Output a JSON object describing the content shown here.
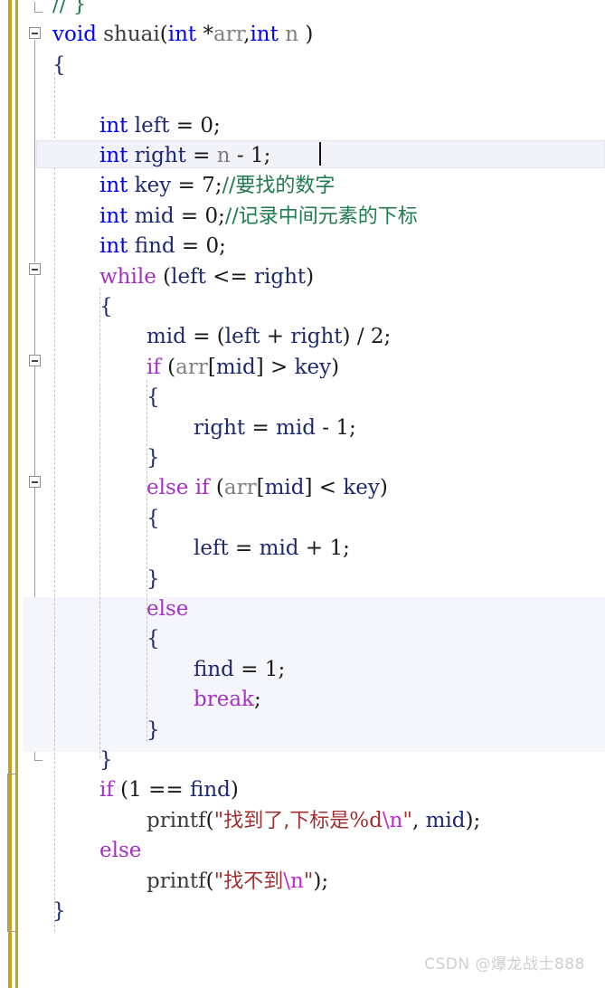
{
  "editor": {
    "language": "C",
    "theme": "light",
    "font_family_style": "serif-monospaced",
    "colors": {
      "background": "#ffffff",
      "keyword": "#0000ff",
      "control_keyword": "#a431c6",
      "identifier": "#1f2a6e",
      "parameter": "#808080",
      "comment": "#1f7a4d",
      "string": "#a03030",
      "escape": "#c02ad0",
      "change_bar": "#C9A21B",
      "current_line_bg": "#f2f3f9",
      "block_highlight_bg": "#f4f6fb",
      "fold_line": "#9a9a9a",
      "indent_guide": "#c2c2c2",
      "watermark": "#cfcfcf"
    },
    "current_line_number": 2,
    "caret_visible": true
  },
  "code": {
    "lines": [
      {
        "n": 0,
        "indent": 0,
        "tokens": [
          {
            "t": "// }",
            "c": "cmt"
          }
        ]
      },
      {
        "n": 1,
        "indent": 0,
        "tokens": [
          {
            "t": "void",
            "c": "kw"
          },
          {
            "t": " ",
            "c": "op"
          },
          {
            "t": "shuai",
            "c": "fn"
          },
          {
            "t": "(",
            "c": "op"
          },
          {
            "t": "int",
            "c": "kw"
          },
          {
            "t": " *",
            "c": "op"
          },
          {
            "t": "arr",
            "c": "par"
          },
          {
            "t": ",",
            "c": "op"
          },
          {
            "t": "int",
            "c": "kw"
          },
          {
            "t": " ",
            "c": "op"
          },
          {
            "t": "n",
            "c": "par"
          },
          {
            "t": " )",
            "c": "op"
          }
        ]
      },
      {
        "n": 2,
        "indent": 0,
        "tokens": [
          {
            "t": "{",
            "c": "brc"
          }
        ]
      },
      {
        "n": 3,
        "indent": 0,
        "tokens": []
      },
      {
        "n": 4,
        "indent": 1,
        "tokens": [
          {
            "t": "int",
            "c": "kw"
          },
          {
            "t": " ",
            "c": "op"
          },
          {
            "t": "left",
            "c": "id"
          },
          {
            "t": " = ",
            "c": "op"
          },
          {
            "t": "0",
            "c": "num"
          },
          {
            "t": ";",
            "c": "op"
          }
        ]
      },
      {
        "n": 5,
        "indent": 1,
        "tokens": [
          {
            "t": "int",
            "c": "kw"
          },
          {
            "t": " ",
            "c": "op"
          },
          {
            "t": "right",
            "c": "id"
          },
          {
            "t": " = ",
            "c": "op"
          },
          {
            "t": "n",
            "c": "par"
          },
          {
            "t": " - ",
            "c": "op"
          },
          {
            "t": "1",
            "c": "num"
          },
          {
            "t": ";",
            "c": "op"
          }
        ]
      },
      {
        "n": 6,
        "indent": 1,
        "tokens": [
          {
            "t": "int",
            "c": "kw"
          },
          {
            "t": " ",
            "c": "op"
          },
          {
            "t": "key",
            "c": "id"
          },
          {
            "t": " = ",
            "c": "op"
          },
          {
            "t": "7",
            "c": "num"
          },
          {
            "t": ";",
            "c": "op"
          },
          {
            "t": "//要找的数字",
            "c": "cmt cjk"
          }
        ]
      },
      {
        "n": 7,
        "indent": 1,
        "tokens": [
          {
            "t": "int",
            "c": "kw"
          },
          {
            "t": " ",
            "c": "op"
          },
          {
            "t": "mid",
            "c": "id"
          },
          {
            "t": " = ",
            "c": "op"
          },
          {
            "t": "0",
            "c": "num"
          },
          {
            "t": ";",
            "c": "op"
          },
          {
            "t": "//记录中间元素的下标",
            "c": "cmt cjk"
          }
        ]
      },
      {
        "n": 8,
        "indent": 1,
        "tokens": [
          {
            "t": "int",
            "c": "kw"
          },
          {
            "t": " ",
            "c": "op"
          },
          {
            "t": "find",
            "c": "id"
          },
          {
            "t": " = ",
            "c": "op"
          },
          {
            "t": "0",
            "c": "num"
          },
          {
            "t": ";",
            "c": "op"
          }
        ]
      },
      {
        "n": 9,
        "indent": 1,
        "tokens": [
          {
            "t": "while",
            "c": "ctl"
          },
          {
            "t": " (",
            "c": "op"
          },
          {
            "t": "left",
            "c": "id"
          },
          {
            "t": " <= ",
            "c": "op"
          },
          {
            "t": "right",
            "c": "id"
          },
          {
            "t": ")",
            "c": "op"
          }
        ]
      },
      {
        "n": 10,
        "indent": 1,
        "tokens": [
          {
            "t": "{",
            "c": "brc"
          }
        ]
      },
      {
        "n": 11,
        "indent": 2,
        "tokens": [
          {
            "t": "mid",
            "c": "id"
          },
          {
            "t": " = (",
            "c": "op"
          },
          {
            "t": "left",
            "c": "id"
          },
          {
            "t": " + ",
            "c": "op"
          },
          {
            "t": "right",
            "c": "id"
          },
          {
            "t": ") / ",
            "c": "op"
          },
          {
            "t": "2",
            "c": "num"
          },
          {
            "t": ";",
            "c": "op"
          }
        ]
      },
      {
        "n": 12,
        "indent": 2,
        "tokens": [
          {
            "t": "if",
            "c": "ctl"
          },
          {
            "t": " (",
            "c": "op"
          },
          {
            "t": "arr",
            "c": "par"
          },
          {
            "t": "[",
            "c": "op"
          },
          {
            "t": "mid",
            "c": "id"
          },
          {
            "t": "] > ",
            "c": "op"
          },
          {
            "t": "key",
            "c": "id"
          },
          {
            "t": ")",
            "c": "op"
          }
        ]
      },
      {
        "n": 13,
        "indent": 2,
        "tokens": [
          {
            "t": "{",
            "c": "brc"
          }
        ]
      },
      {
        "n": 14,
        "indent": 3,
        "tokens": [
          {
            "t": "right",
            "c": "id"
          },
          {
            "t": " = ",
            "c": "op"
          },
          {
            "t": "mid",
            "c": "id"
          },
          {
            "t": " - ",
            "c": "op"
          },
          {
            "t": "1",
            "c": "num"
          },
          {
            "t": ";",
            "c": "op"
          }
        ]
      },
      {
        "n": 15,
        "indent": 2,
        "tokens": [
          {
            "t": "}",
            "c": "brc"
          }
        ]
      },
      {
        "n": 16,
        "indent": 2,
        "tokens": [
          {
            "t": "else",
            "c": "ctl"
          },
          {
            "t": " ",
            "c": "op"
          },
          {
            "t": "if",
            "c": "ctl"
          },
          {
            "t": " (",
            "c": "op"
          },
          {
            "t": "arr",
            "c": "par"
          },
          {
            "t": "[",
            "c": "op"
          },
          {
            "t": "mid",
            "c": "id"
          },
          {
            "t": "] < ",
            "c": "op"
          },
          {
            "t": "key",
            "c": "id"
          },
          {
            "t": ")",
            "c": "op"
          }
        ]
      },
      {
        "n": 17,
        "indent": 2,
        "tokens": [
          {
            "t": "{",
            "c": "brc"
          }
        ]
      },
      {
        "n": 18,
        "indent": 3,
        "tokens": [
          {
            "t": "left",
            "c": "id"
          },
          {
            "t": " = ",
            "c": "op"
          },
          {
            "t": "mid",
            "c": "id"
          },
          {
            "t": " + ",
            "c": "op"
          },
          {
            "t": "1",
            "c": "num"
          },
          {
            "t": ";",
            "c": "op"
          }
        ]
      },
      {
        "n": 19,
        "indent": 2,
        "tokens": [
          {
            "t": "}",
            "c": "brc"
          }
        ]
      },
      {
        "n": 20,
        "indent": 2,
        "tokens": [
          {
            "t": "else",
            "c": "ctl"
          }
        ]
      },
      {
        "n": 21,
        "indent": 2,
        "tokens": [
          {
            "t": "{",
            "c": "brc"
          }
        ]
      },
      {
        "n": 22,
        "indent": 3,
        "tokens": [
          {
            "t": "find",
            "c": "id"
          },
          {
            "t": " = ",
            "c": "op"
          },
          {
            "t": "1",
            "c": "num"
          },
          {
            "t": ";",
            "c": "op"
          }
        ]
      },
      {
        "n": 23,
        "indent": 3,
        "tokens": [
          {
            "t": "break",
            "c": "ctl"
          },
          {
            "t": ";",
            "c": "op"
          }
        ]
      },
      {
        "n": 24,
        "indent": 2,
        "tokens": [
          {
            "t": "}",
            "c": "brc"
          }
        ]
      },
      {
        "n": 25,
        "indent": 1,
        "tokens": [
          {
            "t": "}",
            "c": "brc"
          }
        ]
      },
      {
        "n": 26,
        "indent": 1,
        "tokens": [
          {
            "t": "if",
            "c": "ctl"
          },
          {
            "t": " (",
            "c": "op"
          },
          {
            "t": "1",
            "c": "num"
          },
          {
            "t": " == ",
            "c": "op"
          },
          {
            "t": "find",
            "c": "id"
          },
          {
            "t": ")",
            "c": "op"
          }
        ]
      },
      {
        "n": 27,
        "indent": 2,
        "tokens": [
          {
            "t": "printf",
            "c": "fn"
          },
          {
            "t": "(",
            "c": "op"
          },
          {
            "t": "\"",
            "c": "str"
          },
          {
            "t": "找到了,下标是",
            "c": "str cjk"
          },
          {
            "t": "%d",
            "c": "str"
          },
          {
            "t": "\\n",
            "c": "esc"
          },
          {
            "t": "\"",
            "c": "str"
          },
          {
            "t": ", ",
            "c": "op"
          },
          {
            "t": "mid",
            "c": "id"
          },
          {
            "t": ");",
            "c": "op"
          }
        ]
      },
      {
        "n": 28,
        "indent": 1,
        "tokens": [
          {
            "t": "else",
            "c": "ctl"
          }
        ]
      },
      {
        "n": 29,
        "indent": 2,
        "tokens": [
          {
            "t": "printf",
            "c": "fn"
          },
          {
            "t": "(",
            "c": "op"
          },
          {
            "t": "\"",
            "c": "str"
          },
          {
            "t": "找不到",
            "c": "str cjk"
          },
          {
            "t": "\\n",
            "c": "esc"
          },
          {
            "t": "\"",
            "c": "str"
          },
          {
            "t": ");",
            "c": "op"
          }
        ]
      },
      {
        "n": 30,
        "indent": 0,
        "tokens": [
          {
            "t": "}",
            "c": "brc"
          }
        ]
      }
    ]
  },
  "gutter": {
    "change_bars": 2,
    "fold_markers": [
      {
        "name": "fold-function",
        "expanded": true,
        "line": 1
      },
      {
        "name": "fold-while",
        "expanded": true,
        "line": 9
      },
      {
        "name": "fold-if",
        "expanded": true,
        "line": 12
      },
      {
        "name": "fold-else-if",
        "expanded": true,
        "line": 16
      },
      {
        "name": "fold-else",
        "expanded": true,
        "line": 20
      }
    ]
  },
  "watermark": {
    "text": "CSDN @爆龙战士888"
  }
}
